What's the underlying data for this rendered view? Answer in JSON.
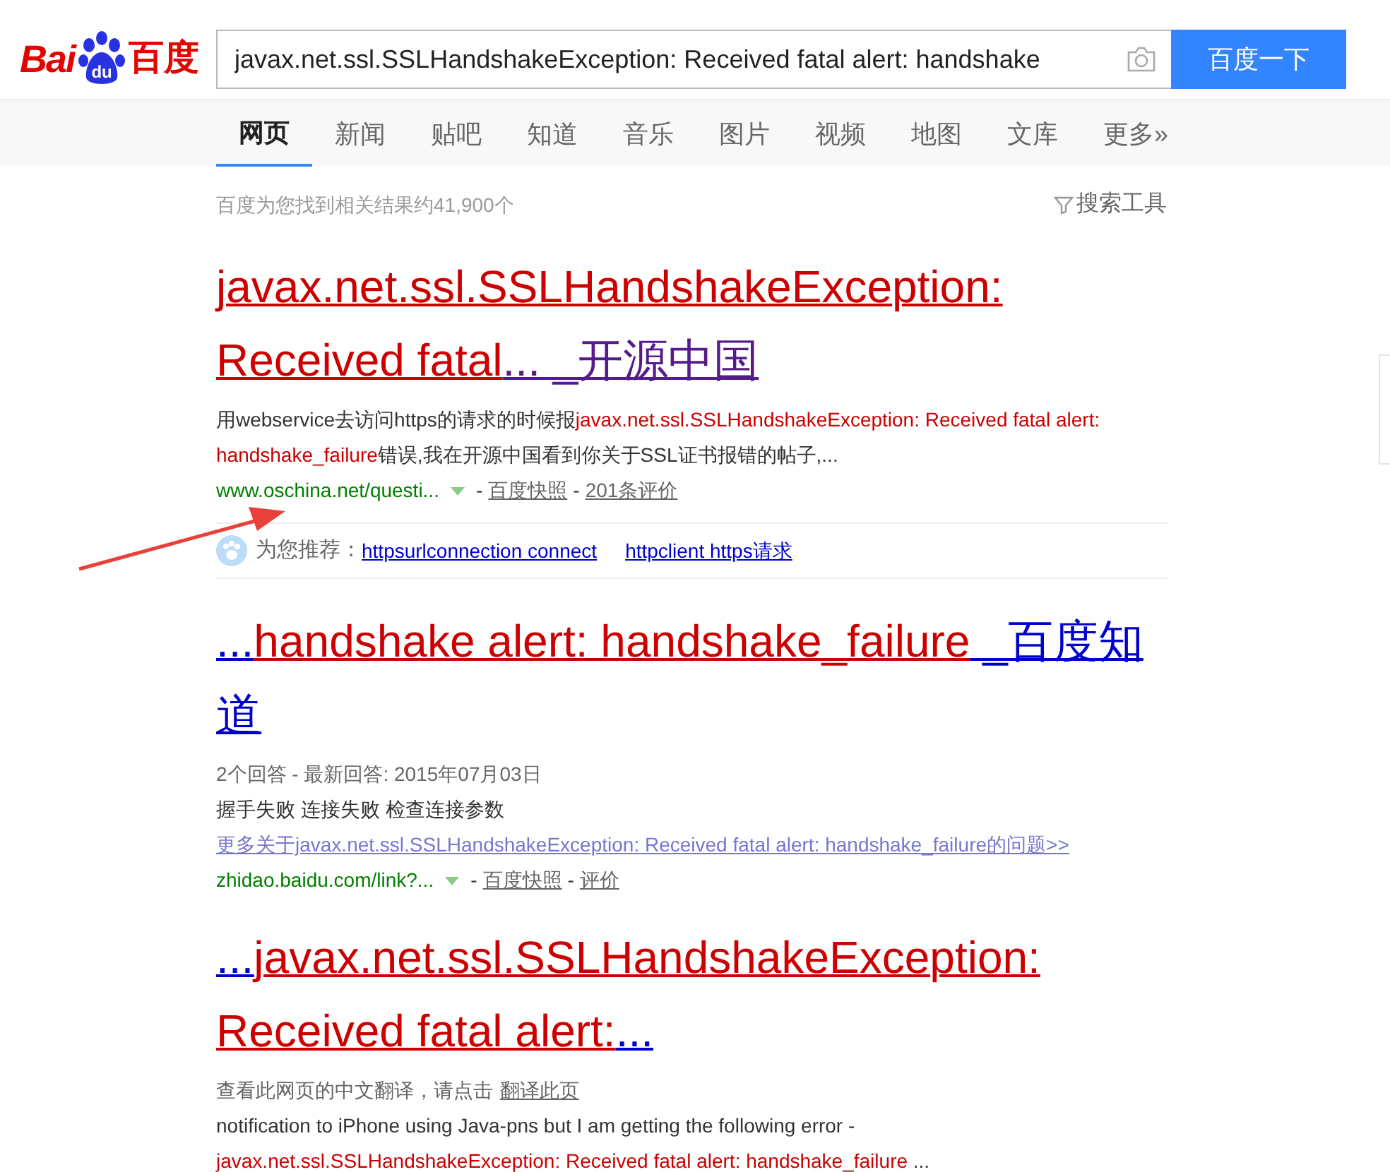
{
  "logo": {
    "latin": "Bai",
    "paw": "du",
    "cn": "百度"
  },
  "search": {
    "value": "javax.net.ssl.SSLHandshakeException: Received fatal alert: handshake",
    "button": "百度一下"
  },
  "tabs": [
    {
      "label": "网页",
      "selected": true
    },
    {
      "label": "新闻",
      "selected": false
    },
    {
      "label": "贴吧",
      "selected": false
    },
    {
      "label": "知道",
      "selected": false
    },
    {
      "label": "音乐",
      "selected": false
    },
    {
      "label": "图片",
      "selected": false
    },
    {
      "label": "视频",
      "selected": false
    },
    {
      "label": "地图",
      "selected": false
    },
    {
      "label": "文库",
      "selected": false
    },
    {
      "label": "更多»",
      "selected": false
    }
  ],
  "result_count": "百度为您找到相关结果约41,900个",
  "tools": "搜索工具",
  "results": [
    {
      "visited": true,
      "title": [
        {
          "text": "javax.net.ssl.SSLHandshakeException: Received fatal",
          "match": true
        },
        {
          "text": "... _开源中国",
          "match": false
        }
      ],
      "lines": [
        {
          "kind": "snippet",
          "segments": [
            {
              "text": "用webservice去访问https的请求的时候报",
              "match": false
            },
            {
              "text": "javax.net.ssl.SSLHandshakeException: Received fatal alert: handshake_failure",
              "match": true
            },
            {
              "text": "错误,我在开源中国看到你关于SSL证书报错的帖子,...",
              "match": false
            }
          ]
        },
        {
          "kind": "url",
          "url": "www.oschina.net/questi...",
          "separator": "-",
          "links": [
            "百度快照",
            "201条评价"
          ]
        },
        {
          "kind": "recommend",
          "label": "为您推荐：",
          "links": [
            "httpsurlconnection connect",
            "httpclient https请求"
          ]
        }
      ]
    },
    {
      "visited": false,
      "title": [
        {
          "text": "...",
          "match": false
        },
        {
          "text": "handshake alert: handshake_failure",
          "match": true
        },
        {
          "text": " _百度知道",
          "match": false
        }
      ],
      "lines": [
        {
          "kind": "meta",
          "text": "2个回答 - 最新回答: 2015年07月03日"
        },
        {
          "kind": "snippet",
          "segments": [
            {
              "text": "握手失败 连接失败 检查连接参数",
              "match": false
            }
          ]
        },
        {
          "kind": "more",
          "text": "更多关于javax.net.ssl.SSLHandshakeException: Received fatal alert: handshake_failure的问题>>"
        },
        {
          "kind": "url",
          "url": "zhidao.baidu.com/link?...",
          "separator": "-",
          "links": [
            "百度快照",
            "评价"
          ]
        }
      ]
    },
    {
      "visited": false,
      "title": [
        {
          "text": "...",
          "match": false
        },
        {
          "text": "javax.net.ssl.SSLHandshakeException: Received fatal alert:",
          "match": true
        },
        {
          "text": "...",
          "match": false
        }
      ],
      "lines": [
        {
          "kind": "translate",
          "text": "查看此网页的中文翻译，请点击",
          "link": "翻译此页"
        },
        {
          "kind": "snippet",
          "segments": [
            {
              "text": "notification to iPhone using Java-pns but I am getting the following error -",
              "match": false
            }
          ]
        },
        {
          "kind": "snippet",
          "segments": [
            {
              "text": "javax.net.ssl.SSLHandshakeException: Received fatal alert: handshake_failure",
              "match": true
            },
            {
              "text": " ...",
              "match": false
            }
          ]
        }
      ]
    }
  ]
}
